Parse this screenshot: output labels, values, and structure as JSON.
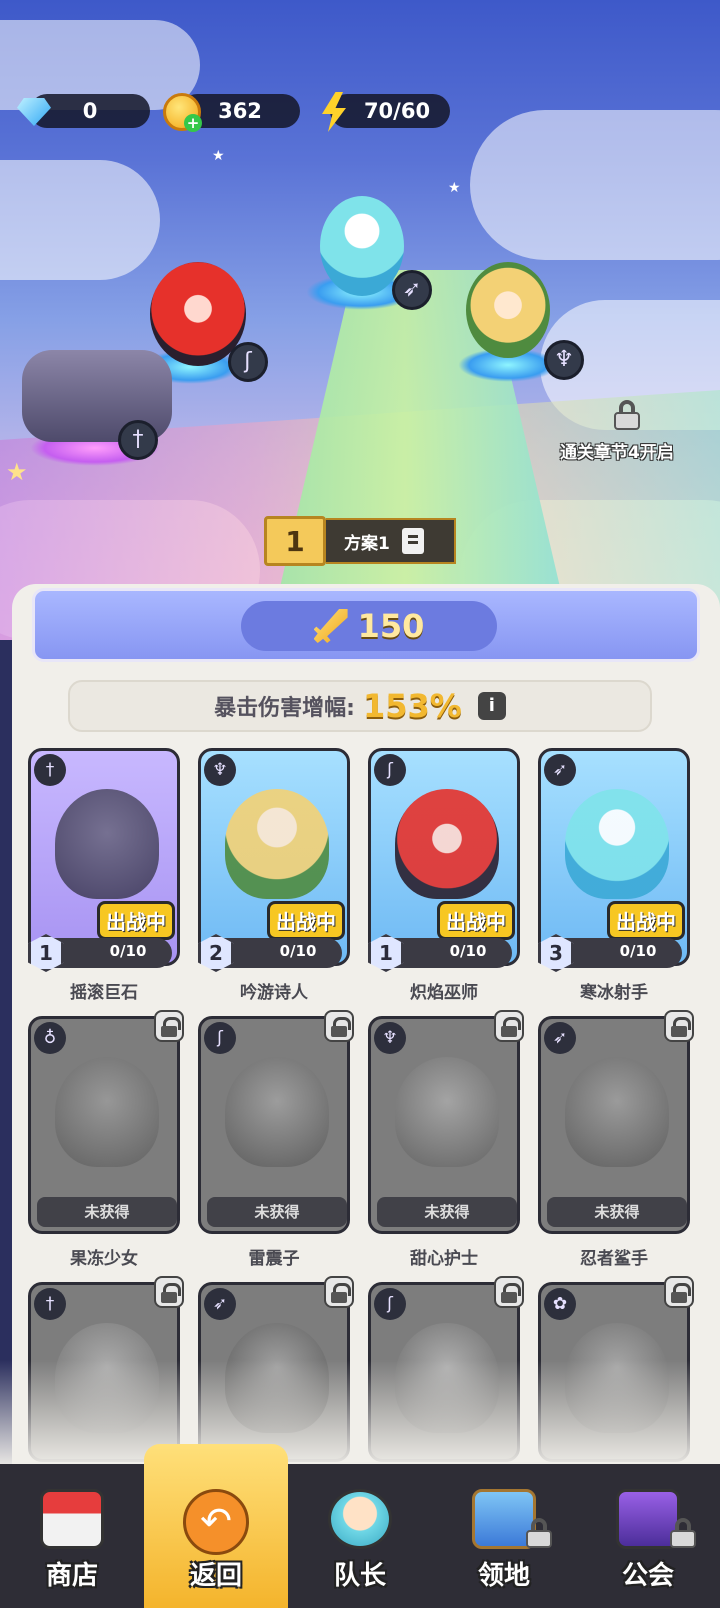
{
  "resources": {
    "gems": "0",
    "gold": "362",
    "energy": "70/60"
  },
  "team": {
    "locked_slot_text": "通关章节4开启",
    "plan_number": "1",
    "plan_name": "方案1"
  },
  "power": {
    "value": "150"
  },
  "crit": {
    "label": "暴击伤害增幅:",
    "value": "153%"
  },
  "heroes": [
    {
      "name": "摇滚巨石",
      "class_icon": "sword-icon",
      "status": "出战中",
      "level": "1",
      "progress": "0/10"
    },
    {
      "name": "吟游诗人",
      "class_icon": "wings-icon",
      "status": "出战中",
      "level": "2",
      "progress": "0/10"
    },
    {
      "name": "炽焰巫师",
      "class_icon": "staff-icon",
      "status": "出战中",
      "level": "1",
      "progress": "0/10"
    },
    {
      "name": "寒冰射手",
      "class_icon": "bow-icon",
      "status": "出战中",
      "level": "3",
      "progress": "0/10"
    },
    {
      "name": "果冻少女",
      "class_icon": "potion-icon",
      "status": "未获得"
    },
    {
      "name": "雷震子",
      "class_icon": "staff-icon",
      "status": "未获得"
    },
    {
      "name": "甜心护士",
      "class_icon": "wings-icon",
      "status": "未获得"
    },
    {
      "name": "忍者鲨手",
      "class_icon": "bow-icon",
      "status": "未获得"
    }
  ],
  "nav": {
    "shop": "商店",
    "back": "返回",
    "captain": "队长",
    "territory": "领地",
    "guild": "公会"
  }
}
